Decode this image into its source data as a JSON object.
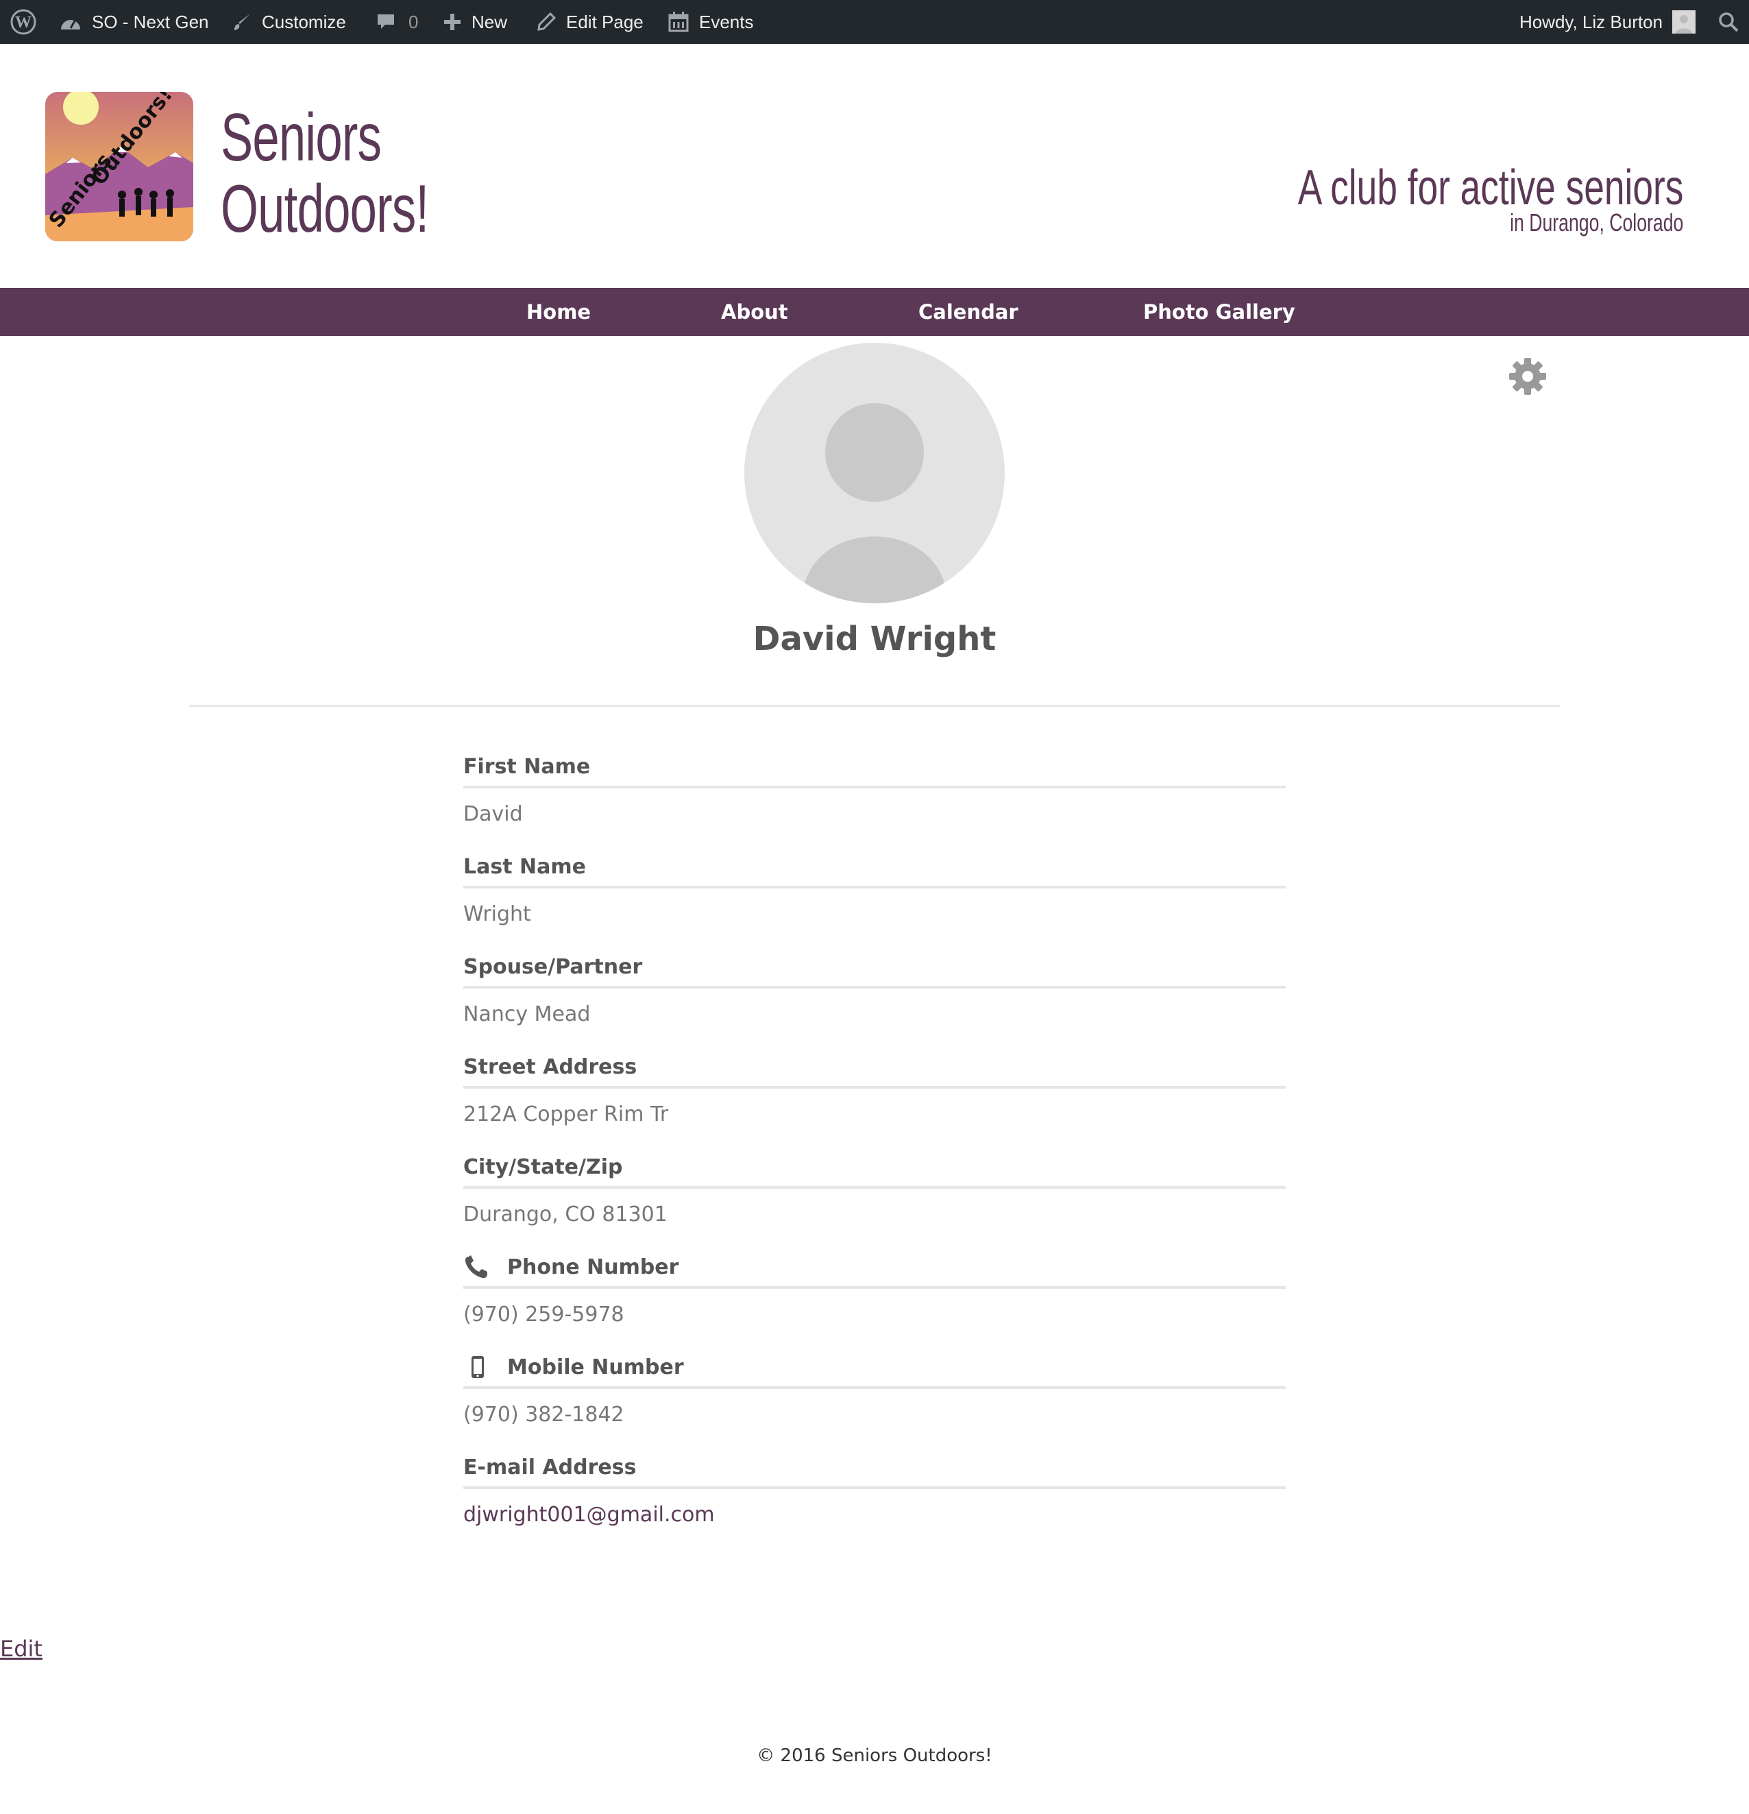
{
  "admin_bar": {
    "site_name": "SO - Next Gen",
    "customize": "Customize",
    "comments_count": "0",
    "new": "New",
    "edit_page": "Edit Page",
    "events": "Events",
    "howdy": "Howdy, Liz Burton"
  },
  "header": {
    "title_line1": "Seniors",
    "title_line2": "Outdoors!",
    "tagline": "A club for active seniors",
    "tagline_sub": "in Durango, Colorado"
  },
  "nav": {
    "items": [
      "Home",
      "About",
      "Calendar",
      "Photo Gallery"
    ]
  },
  "profile": {
    "name": "David Wright",
    "fields": [
      {
        "label": "First Name",
        "value": "David",
        "icon": ""
      },
      {
        "label": "Last Name",
        "value": "Wright",
        "icon": ""
      },
      {
        "label": "Spouse/Partner",
        "value": "Nancy Mead",
        "icon": ""
      },
      {
        "label": "Street Address",
        "value": "212A Copper Rim Tr",
        "icon": ""
      },
      {
        "label": "City/State/Zip",
        "value": "Durango, CO 81301",
        "icon": ""
      },
      {
        "label": "Phone Number",
        "value": "(970) 259-5978",
        "icon": "phone-icon"
      },
      {
        "label": "Mobile Number",
        "value": "(970) 382-1842",
        "icon": "mobile-icon"
      },
      {
        "label": "E-mail Address",
        "value": "djwright001@gmail.com",
        "icon": ""
      }
    ]
  },
  "edit_link": "Edit",
  "footer": "© 2016 Seniors Outdoors!",
  "colors": {
    "brand": "#5a3856",
    "admin_bar": "#23282d"
  }
}
